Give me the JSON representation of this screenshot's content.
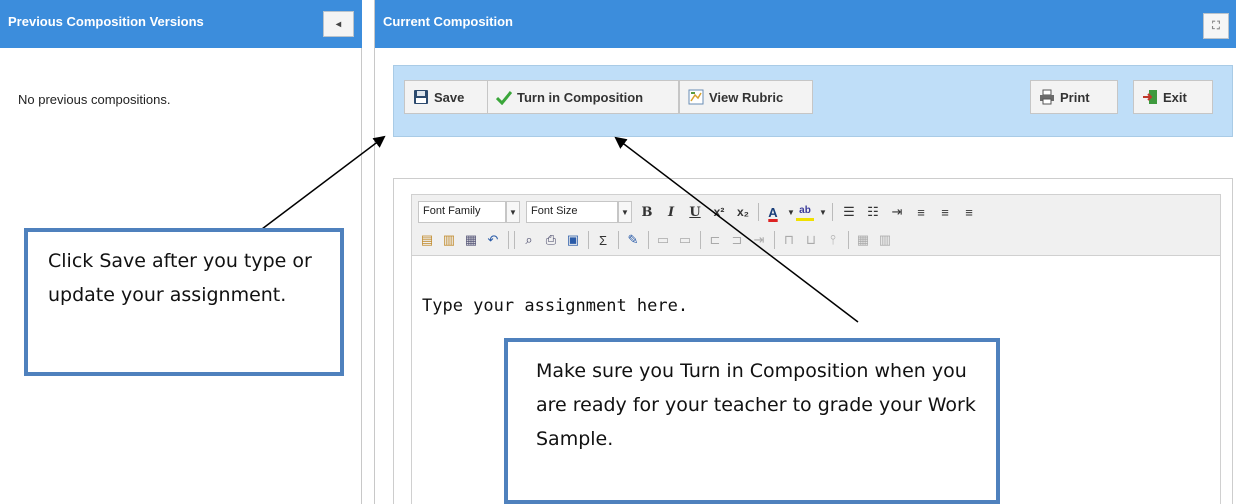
{
  "left_panel": {
    "title": "Previous Composition Versions",
    "collapse_glyph": "◂",
    "empty_message": "No previous compositions."
  },
  "right_panel": {
    "title": "Current Composition",
    "expand_glyph": "⛶",
    "toolbar": {
      "save_label": "Save",
      "turn_in_label": "Turn in Composition",
      "view_rubric_label": "View Rubric",
      "print_label": "Print",
      "exit_label": "Exit"
    },
    "editor": {
      "font_family_label": "Font Family",
      "font_size_label": "Font Size",
      "content_text": "Type your assignment here."
    }
  },
  "callouts": {
    "save_callout": "Click Save after you type or update your assignment.",
    "turn_in_callout": "Make sure you Turn in Composition when you are ready for your teacher to grade your Work Sample."
  },
  "colors": {
    "header_blue": "#3c8ddc",
    "toolbar_blue": "#bfdef8",
    "callout_border": "#4f81bd"
  }
}
